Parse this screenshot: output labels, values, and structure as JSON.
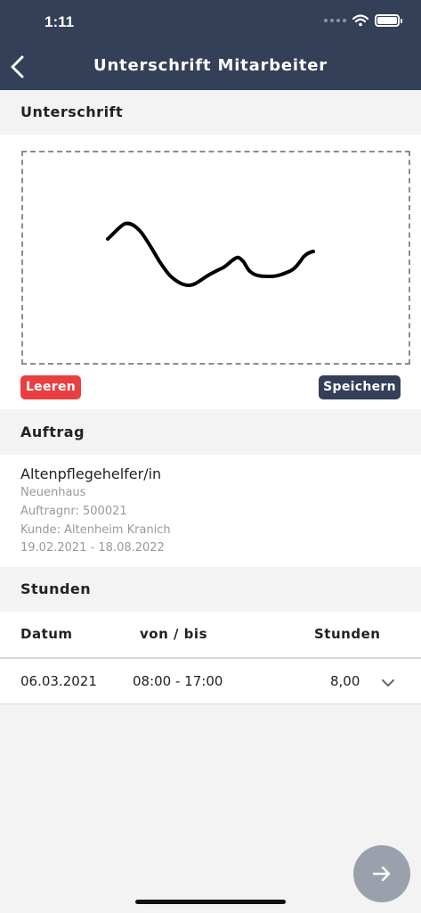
{
  "status_bar": {
    "time": "1:11"
  },
  "header": {
    "title": "Unterschrift Mitarbeiter"
  },
  "signature": {
    "section_title": "Unterschrift",
    "clear_label": "Leeren",
    "save_label": "Speichern"
  },
  "order": {
    "section_title": "Auftrag",
    "job_title": "Altenpflegehelfer/in",
    "location": "Neuenhaus",
    "order_number": "Auftragnr: 500021",
    "customer": "Kunde: Altenheim Kranich",
    "period": "19.02.2021 - 18.08.2022"
  },
  "hours": {
    "section_title": "Stunden",
    "columns": [
      "Datum",
      "von / bis",
      "Stunden"
    ],
    "rows": [
      {
        "date": "06.03.2021",
        "time_range": "08:00 - 17:00",
        "hours": "8,00"
      }
    ]
  },
  "colors": {
    "header_bg": "#343f58",
    "clear_button": "#e84040",
    "save_button": "#343f58",
    "fab": "#9aa1ad"
  },
  "icons": {
    "back": "chevron-left-icon",
    "expand_row": "chevron-down-icon",
    "next": "arrow-right-icon"
  }
}
